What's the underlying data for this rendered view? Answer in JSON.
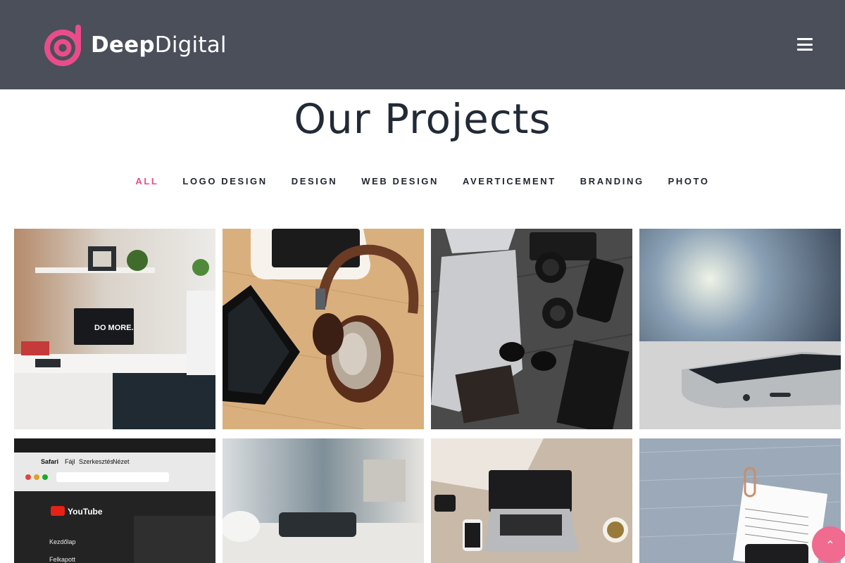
{
  "brand": {
    "name_bold": "Deep",
    "name_light": "Digital",
    "accent": "#ea4c89"
  },
  "header": {
    "menu_icon": "hamburger-icon"
  },
  "page": {
    "title": "Our Projects"
  },
  "filters": [
    {
      "label": "ALL",
      "active": true
    },
    {
      "label": "LOGO DESIGN",
      "active": false
    },
    {
      "label": "DESIGN",
      "active": false
    },
    {
      "label": "WEB DESIGN",
      "active": false
    },
    {
      "label": "AVERTICEMENT",
      "active": false
    },
    {
      "label": "BRANDING",
      "active": false
    },
    {
      "label": "PHOTO",
      "active": false
    }
  ],
  "projects": [
    {
      "subject": "desk-setup-do-more",
      "monitor_text": "DO MORE."
    },
    {
      "subject": "headphones-and-tablet"
    },
    {
      "subject": "camera-laptop-sunglasses"
    },
    {
      "subject": "smartphone-closeup"
    },
    {
      "subject": "browser-screen",
      "browser_menu": [
        "Safari",
        "Fájl",
        "Szerkesztés",
        "Nézet"
      ],
      "sidebar_items": [
        "Kezdőlap",
        "Felkapott"
      ],
      "logo_text": "YouTube"
    },
    {
      "subject": "coffee-cup-desk"
    },
    {
      "subject": "laptop-phone-coffee"
    },
    {
      "subject": "notebook-with-clip"
    }
  ],
  "back_to_top": {
    "icon": "chevron-up-icon",
    "glyph": "⌃"
  }
}
